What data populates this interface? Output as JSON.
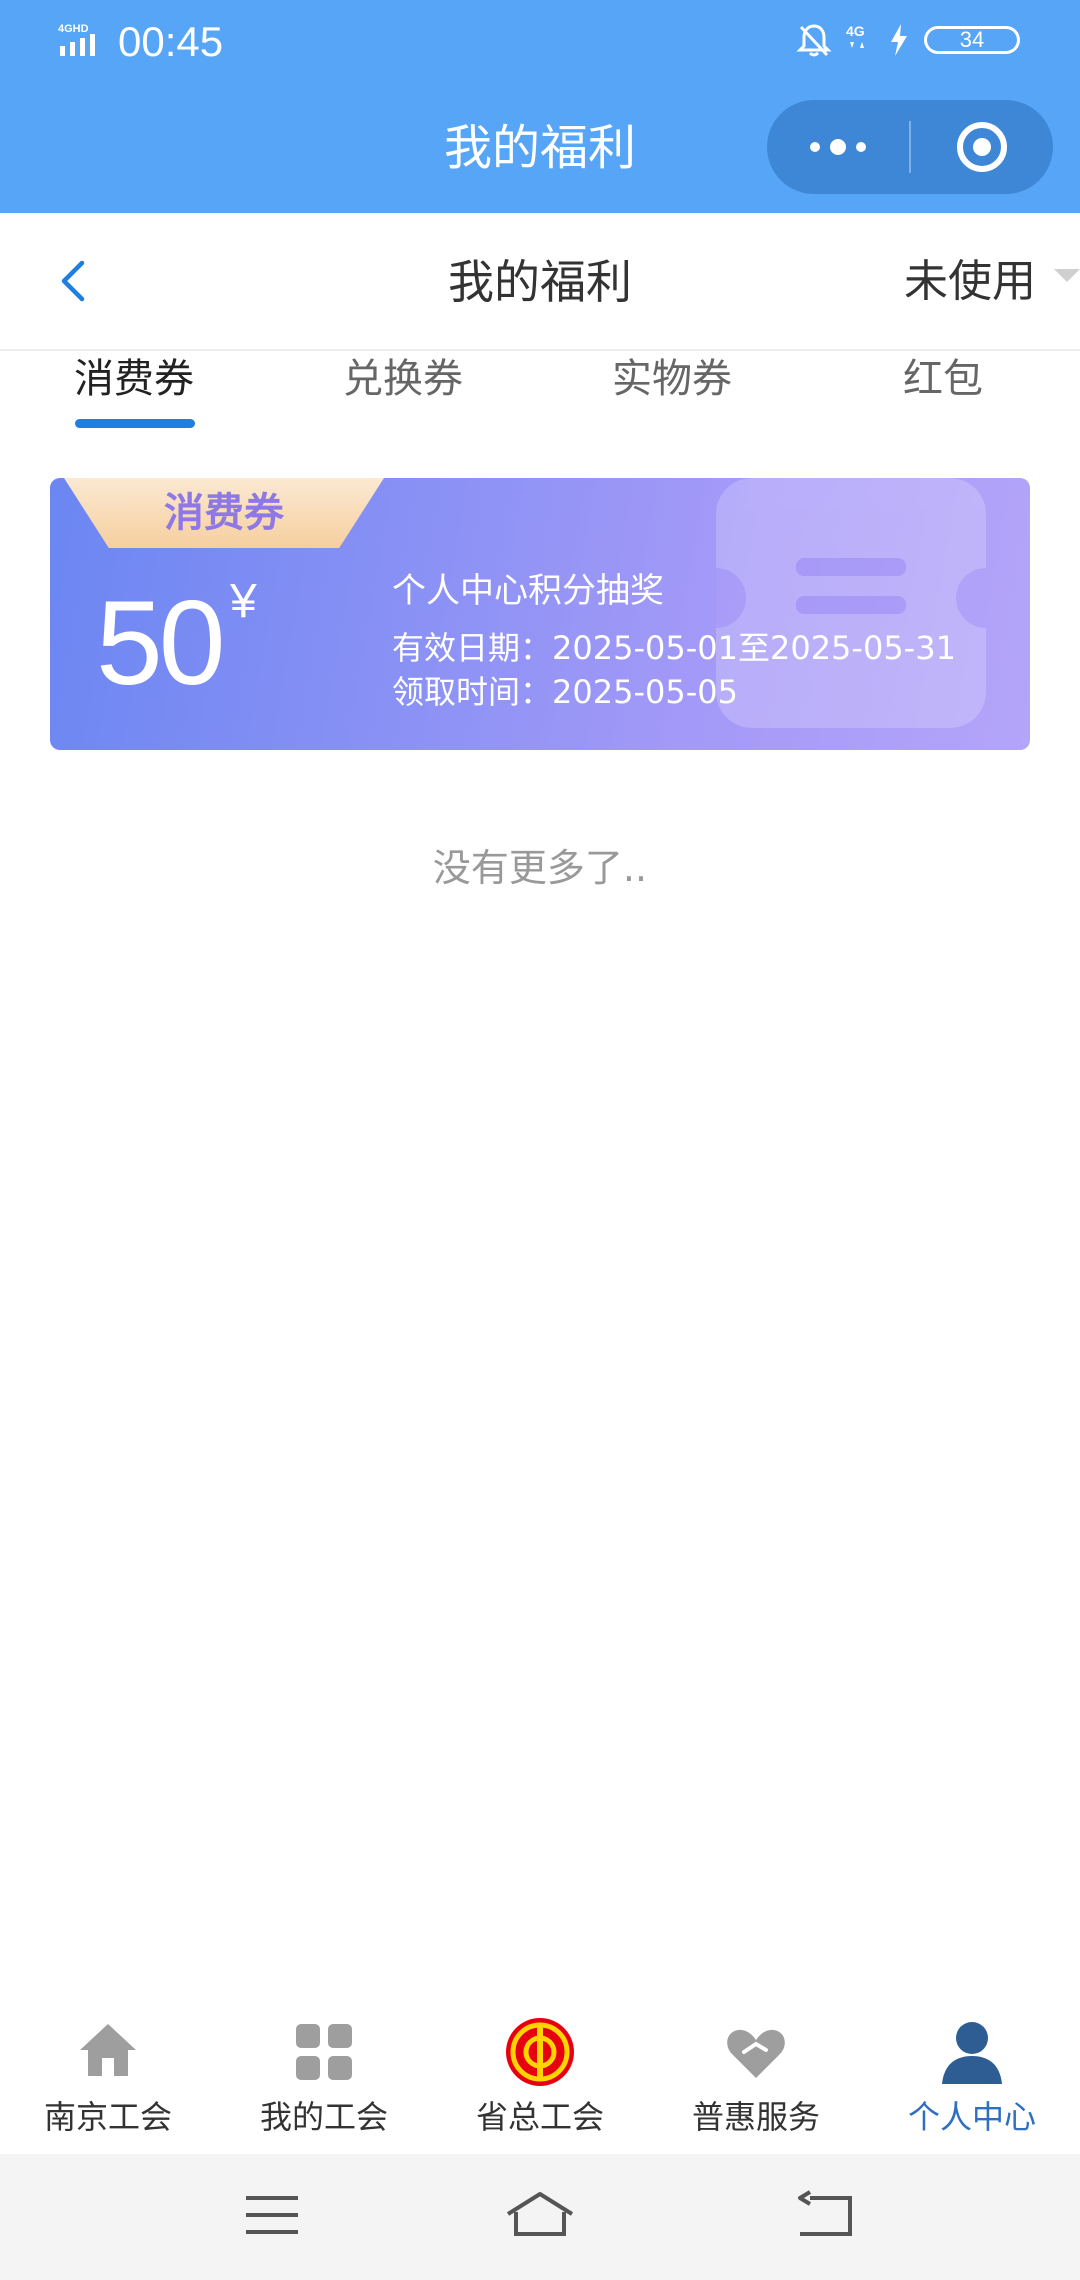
{
  "status": {
    "network": "4GHD",
    "time": "00:45",
    "net2": "4G",
    "battery": "34"
  },
  "miniapp": {
    "title": "我的福利"
  },
  "nav": {
    "title": "我的福利",
    "filter": "未使用"
  },
  "tabs": [
    {
      "label": "消费券",
      "active": true
    },
    {
      "label": "兑换券",
      "active": false
    },
    {
      "label": "实物券",
      "active": false
    },
    {
      "label": "红包",
      "active": false
    }
  ],
  "coupon": {
    "type": "消费券",
    "amount": "50",
    "currency": "¥",
    "name": "个人中心积分抽奖",
    "valid": "有效日期：2025-05-01至2025-05-31",
    "received": "领取时间：2025-05-05"
  },
  "no_more": "没有更多了..",
  "bottom_nav": [
    {
      "label": "南京工会",
      "icon": "home-icon"
    },
    {
      "label": "我的工会",
      "icon": "grid-icon"
    },
    {
      "label": "省总工会",
      "icon": "union-emblem-icon"
    },
    {
      "label": "普惠服务",
      "icon": "heart-icon"
    },
    {
      "label": "个人中心",
      "icon": "person-icon",
      "active": true
    }
  ],
  "colors": {
    "header": "#57a5f6",
    "accent": "#1e7fe0",
    "active_nav": "#2f6fc0"
  }
}
